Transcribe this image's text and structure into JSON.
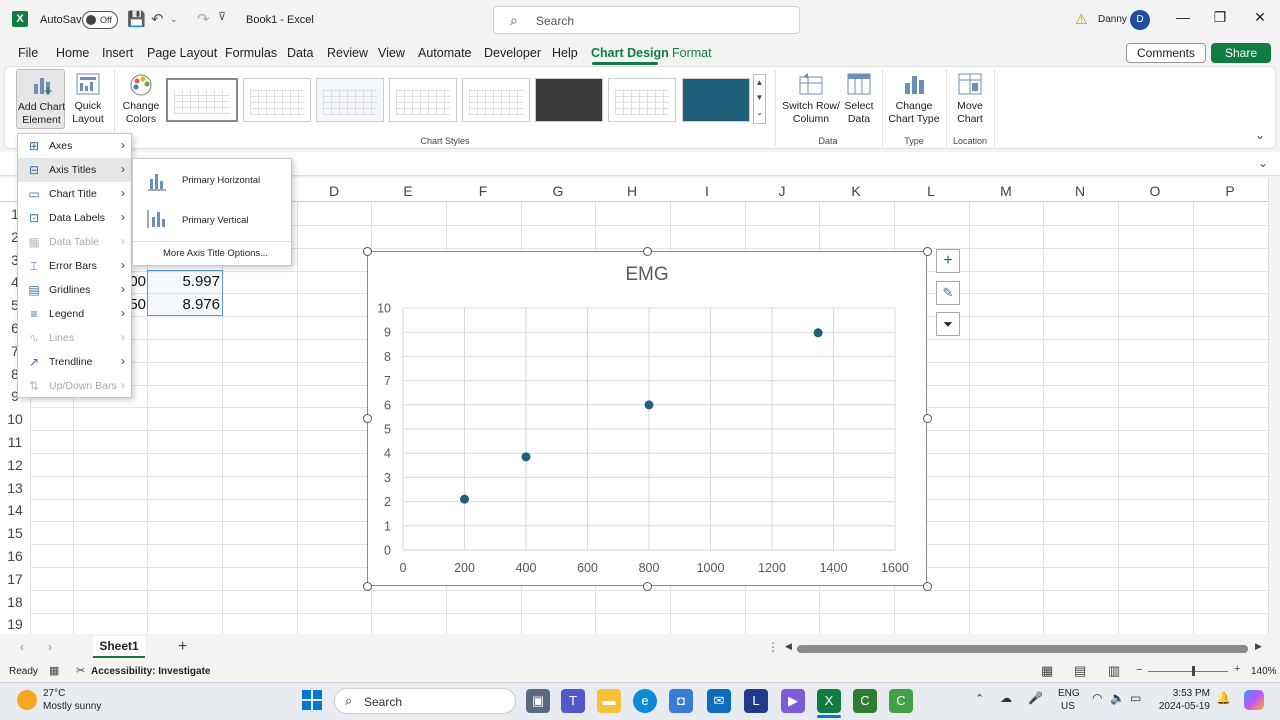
{
  "app": {
    "autosave_label": "AutoSave",
    "autosave_state": "Off",
    "document_title": "Book1  -  Excel",
    "search_placeholder": "Search",
    "user_name": "Danny",
    "user_initial": "D"
  },
  "menu_tabs": [
    "File",
    "Home",
    "Insert",
    "Page Layout",
    "Formulas",
    "Data",
    "Review",
    "View",
    "Automate",
    "Developer",
    "Help",
    "Chart Design",
    "Format"
  ],
  "active_tab": "Chart Design",
  "buttons": {
    "comments": "Comments",
    "share": "Share"
  },
  "ribbon": {
    "add_chart_element": [
      "Add Chart",
      "Element"
    ],
    "quick_layout": [
      "Quick",
      "Layout"
    ],
    "change_colors": [
      "Change",
      "Colors"
    ],
    "switch_row_column": [
      "Switch Row/",
      "Column"
    ],
    "select_data": [
      "Select",
      "Data"
    ],
    "change_chart_type": [
      "Change",
      "Chart Type"
    ],
    "move_chart": [
      "Move",
      "Chart"
    ],
    "groups": {
      "chart_styles": "Chart Styles",
      "data": "Data",
      "type": "Type",
      "location": "Location"
    }
  },
  "columns": [
    "D",
    "E",
    "F",
    "G",
    "H",
    "I",
    "J",
    "K",
    "L",
    "M",
    "N",
    "O",
    "P"
  ],
  "rows": [
    "1",
    "2",
    "3",
    "4",
    "5",
    "6",
    "7",
    "8",
    "9",
    "10",
    "11",
    "12",
    "13",
    "14",
    "15",
    "16",
    "17",
    "18",
    "19"
  ],
  "cells": {
    "a4_partial": "00",
    "b4": "5.997",
    "a5_partial": "50",
    "b5": "8.976"
  },
  "add_chart_element_menu": [
    {
      "label": "Axes",
      "enabled": true
    },
    {
      "label": "Axis Titles",
      "enabled": true
    },
    {
      "label": "Chart Title",
      "enabled": true
    },
    {
      "label": "Data Labels",
      "enabled": true
    },
    {
      "label": "Data Table",
      "enabled": false
    },
    {
      "label": "Error Bars",
      "enabled": true
    },
    {
      "label": "Gridlines",
      "enabled": true
    },
    {
      "label": "Legend",
      "enabled": true
    },
    {
      "label": "Lines",
      "enabled": false
    },
    {
      "label": "Trendline",
      "enabled": true
    },
    {
      "label": "Up/Down Bars",
      "enabled": false
    }
  ],
  "axis_titles_submenu": {
    "primary_horizontal": "Primary Horizontal",
    "primary_vertical": "Primary Vertical",
    "more_options": "More Axis Title Options..."
  },
  "chart_data": {
    "type": "scatter",
    "title": "EMG",
    "x": [
      200,
      400,
      800,
      1350
    ],
    "y": [
      2.1,
      3.85,
      5.997,
      8.976
    ],
    "xlim": [
      0,
      1600
    ],
    "ylim": [
      0,
      10
    ],
    "x_ticks": [
      "0",
      "200",
      "400",
      "600",
      "800",
      "1000",
      "1200",
      "1400",
      "1600"
    ],
    "y_ticks": [
      "0",
      "1",
      "2",
      "3",
      "4",
      "5",
      "6",
      "7",
      "8",
      "9",
      "10"
    ],
    "grid": true,
    "marker_color": "#1f5f7a"
  },
  "sheet": {
    "tab_name": "Sheet1"
  },
  "status": {
    "ready": "Ready",
    "accessibility": "Accessibility: Investigate",
    "zoom": "140%"
  },
  "taskbar": {
    "temperature": "27°C",
    "weather": "Mostly sunny",
    "search_placeholder": "Search",
    "language": "ENG",
    "region": "US",
    "time": "3:53 PM",
    "date": "2024-05-19"
  }
}
